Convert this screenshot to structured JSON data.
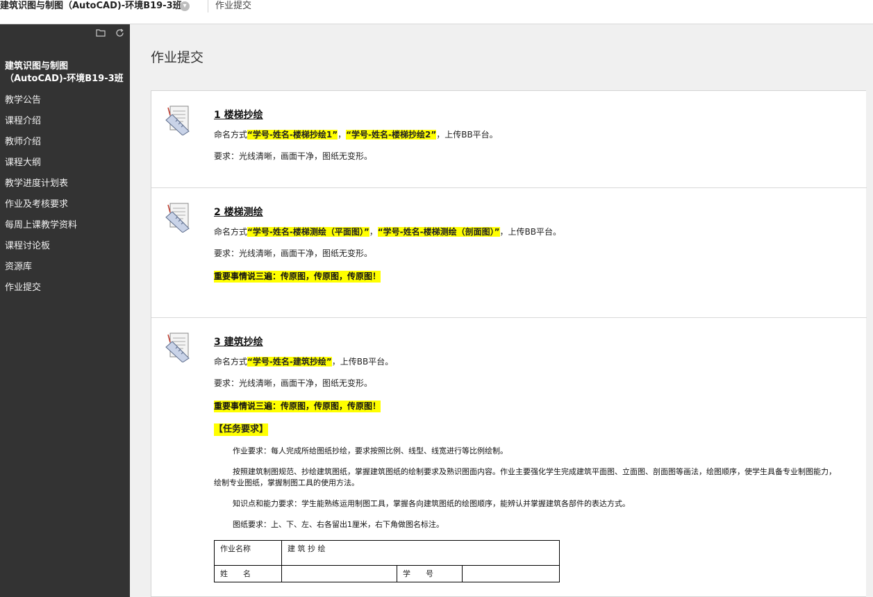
{
  "topbar": {
    "course_title": "建筑识图与制图（AutoCAD)-环境B19-3班",
    "page": "作业提交"
  },
  "sidebar": {
    "course_line1": "建筑识图与制图",
    "course_line2": "（AutoCAD)-环境B19-3班",
    "items": [
      {
        "label": "教学公告"
      },
      {
        "label": "课程介绍"
      },
      {
        "label": "教师介绍"
      },
      {
        "label": "课程大纲"
      },
      {
        "label": "教学进度计划表"
      },
      {
        "label": "作业及考核要求"
      },
      {
        "label": "每周上课教学资料"
      },
      {
        "label": "课程讨论板"
      },
      {
        "label": "资源库"
      },
      {
        "label": "作业提交"
      }
    ]
  },
  "main": {
    "heading": "作业提交",
    "items": [
      {
        "title": "1 楼梯抄绘",
        "naming_prefix": "命名方式",
        "name1": "“学号-姓名-楼梯抄绘1”",
        "sep": "，",
        "name2": "“学号-姓名-楼梯抄绘2”",
        "naming_suffix": "，上传BB平台。",
        "requirement": "要求：光线清晰，画面干净，图纸无变形。"
      },
      {
        "title": "2 楼梯测绘",
        "naming_prefix": "命名方式",
        "name1": "“学号-姓名-楼梯测绘（平面图）”",
        "sep": "，",
        "name2": "“学号-姓名-楼梯测绘（剖面图）”",
        "naming_suffix": "，上传BB平台。",
        "requirement": "要求：光线清晰，画面干净，图纸无变形。",
        "important": "重要事情说三遍：传原图，传原图，传原图！"
      },
      {
        "title": "3 建筑抄绘",
        "naming_prefix": "命名方式",
        "name1": "“学号-姓名-建筑抄绘”",
        "naming_suffix": "，上传BB平台。",
        "requirement": "要求：光线清晰，画面干净，图纸无变形。",
        "important": "重要事情说三遍：传原图，传原图，传原图！",
        "task_title": "【任务要求】",
        "paragraphs": [
          "作业要求：每人完成所给图纸抄绘，要求按照比例、线型、线宽进行等比例绘制。",
          "按照建筑制图规范、抄绘建筑图纸，掌握建筑图纸的绘制要求及熟识图面内容。作业主要强化学生完成建筑平面图、立面图、剖面图等画法，绘图顺序，使学生具备专业制图能力，绘制专业图纸，掌握制图工具的使用方法。",
          "知识点和能力要求：学生能熟练运用制图工具，掌握各向建筑图纸的绘图顺序，能辨认并掌握建筑各部件的表达方式。",
          "图纸要求：上、下、左、右各留出1厘米，右下角做图名标注。"
        ],
        "table": {
          "label_hw": "作业名称",
          "value_hw": "建 筑 抄 绘",
          "label_name": "姓　　名",
          "label_id": "学　　号"
        }
      }
    ]
  },
  "icons": {
    "top_chevron": "chevron-down-icon",
    "folder": "folder-icon",
    "refresh": "refresh-icon",
    "assignment": "assignment-icon"
  }
}
